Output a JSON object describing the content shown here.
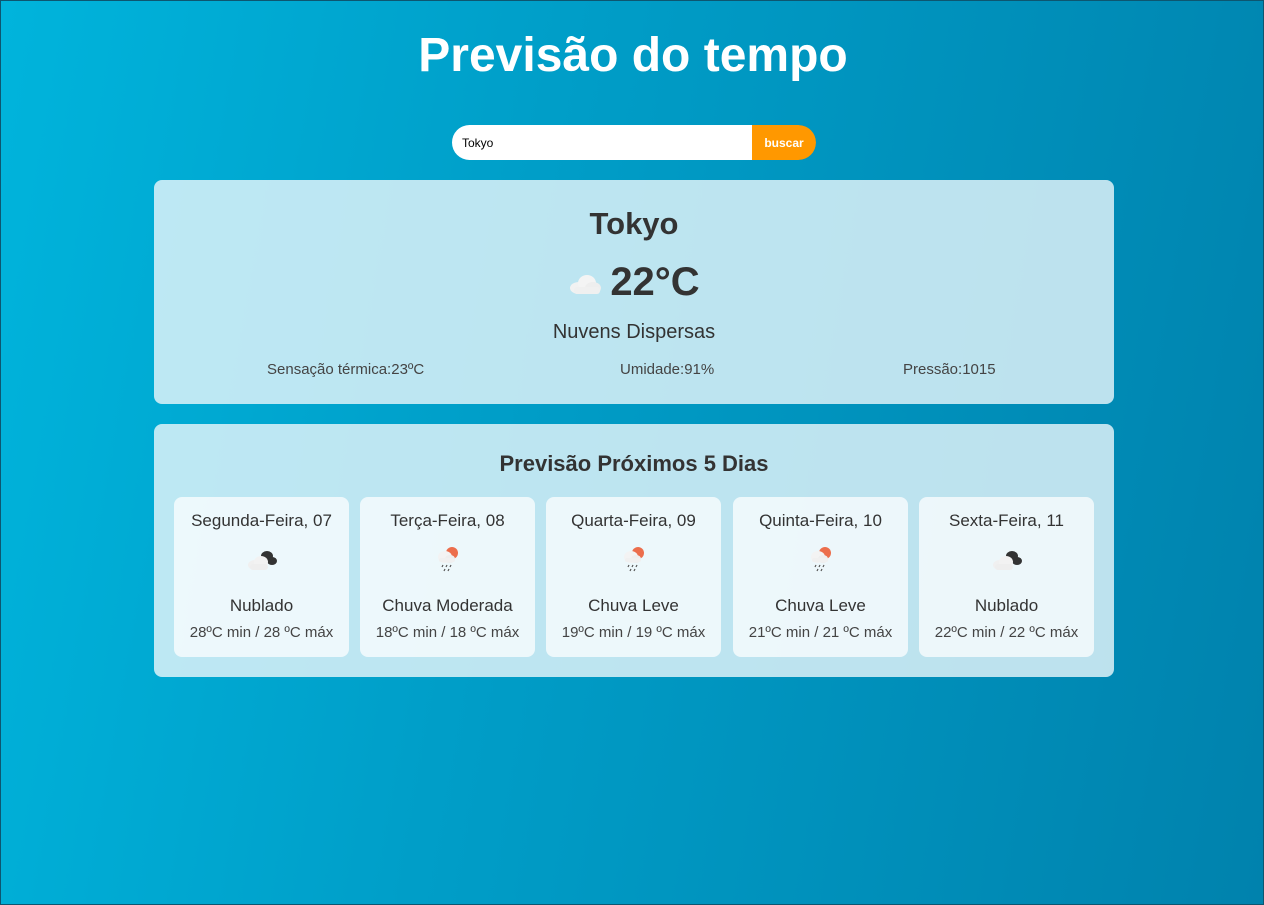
{
  "title": "Previsão do tempo",
  "search": {
    "value": "Tokyo",
    "button_label": "buscar"
  },
  "current": {
    "city": "Tokyo",
    "icon": "cloud-icon",
    "temperature": "22°C",
    "description": "Nuvens Dispersas",
    "feels_like": "Sensação térmica:23ºC",
    "humidity": "Umidade:91%",
    "pressure": "Pressão:1015"
  },
  "forecast": {
    "title": "Previsão Próximos 5 Dias",
    "days": [
      {
        "day": "Segunda-Feira, 07",
        "icon": "broken-clouds-icon",
        "description": "Nublado",
        "temps": "28ºC min / 28 ºC máx"
      },
      {
        "day": "Terça-Feira, 08",
        "icon": "sun-rain-icon",
        "description": "Chuva Moderada",
        "temps": "18ºC min / 18 ºC máx"
      },
      {
        "day": "Quarta-Feira, 09",
        "icon": "sun-rain-icon",
        "description": "Chuva Leve",
        "temps": "19ºC min / 19 ºC máx"
      },
      {
        "day": "Quinta-Feira, 10",
        "icon": "sun-rain-icon",
        "description": "Chuva Leve",
        "temps": "21ºC min / 21 ºC máx"
      },
      {
        "day": "Sexta-Feira, 11",
        "icon": "broken-clouds-icon",
        "description": "Nublado",
        "temps": "22ºC min / 22 ºC máx"
      }
    ]
  },
  "colors": {
    "accent": "#ff9800",
    "text": "#333333"
  }
}
